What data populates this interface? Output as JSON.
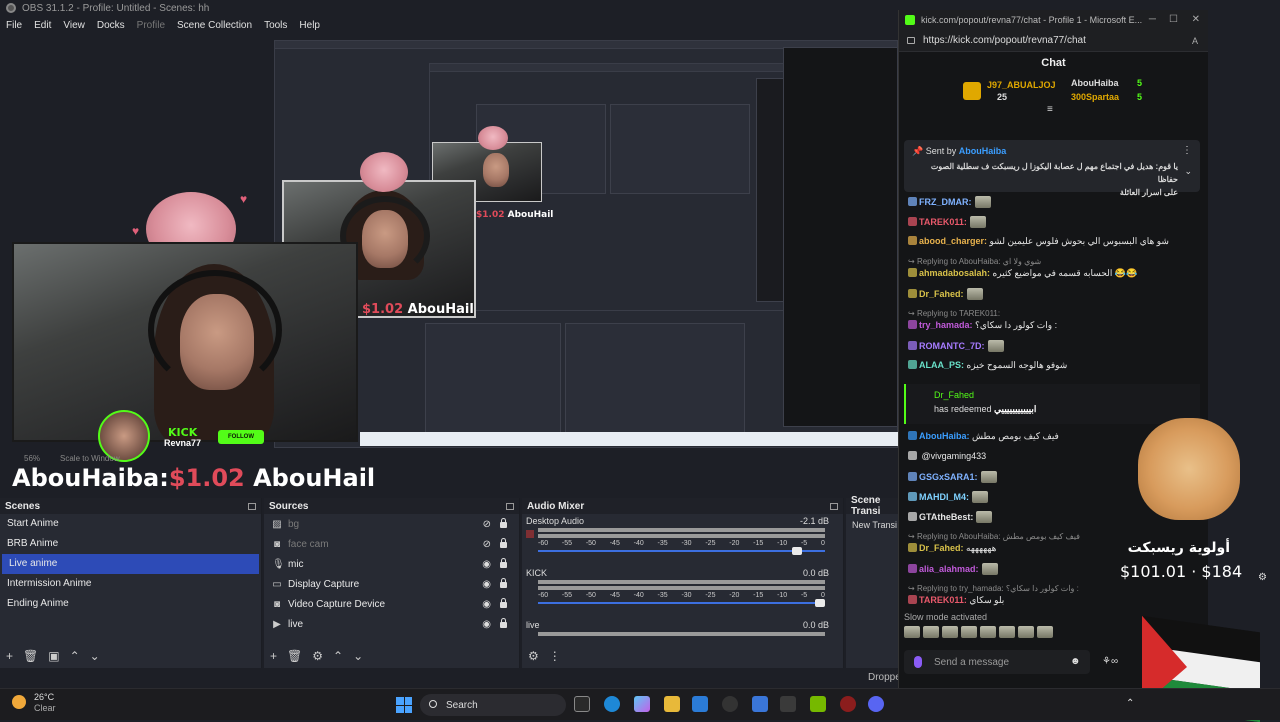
{
  "window": {
    "title": "OBS 31.1.2 - Profile: Untitled - Scenes: hh"
  },
  "menu": [
    "File",
    "Edit",
    "View",
    "Docks",
    "Profile",
    "Scene Collection",
    "Tools",
    "Help"
  ],
  "preview": {
    "kick_label": "KICK",
    "streamer_name": "Revna77",
    "follow_label": "FOLLOW",
    "donation_name": "AbouHail",
    "donation_amount": "$1.02",
    "big_overlay_prefix": "AbouHaiba:",
    "big_overlay_amount": "$1.02",
    "big_overlay_name": "AbouHail",
    "zoom": "56%",
    "scale_label": "Scale to Window"
  },
  "docks": {
    "scenes": {
      "title": "Scenes",
      "items": [
        "Start Anime",
        "BRB Anime",
        "Live anime",
        "Intermission Anime",
        "Ending Anime"
      ],
      "active_index": 2
    },
    "sources": {
      "title": "Sources",
      "items": [
        {
          "label": "bg",
          "icon": "image-icon",
          "hidden": true
        },
        {
          "label": "face cam",
          "icon": "camera-icon",
          "hidden": true
        },
        {
          "label": "mic",
          "icon": "mic-icon",
          "hidden": false
        },
        {
          "label": "Display Capture",
          "icon": "monitor-icon",
          "hidden": false
        },
        {
          "label": "Video Capture Device",
          "icon": "camera-icon",
          "hidden": false
        },
        {
          "label": "live",
          "icon": "play-icon",
          "hidden": false
        }
      ]
    },
    "mixer": {
      "title": "Audio Mixer",
      "channels": [
        {
          "label": "Desktop Audio",
          "db": "-2.1 dB",
          "level": 0.92
        },
        {
          "label": "KICK",
          "db": "0.0 dB",
          "level": 1.0
        },
        {
          "label": "live",
          "db": "0.0 dB",
          "level": 1.0
        }
      ],
      "ticks": [
        "-60",
        "-55",
        "-50",
        "-45",
        "-40",
        "-35",
        "-30",
        "-25",
        "-20",
        "-15",
        "-10",
        "-5",
        "0"
      ]
    },
    "transitions": {
      "title": "Scene Transi",
      "button": "New Transi"
    }
  },
  "status": {
    "dropped": "Droppe"
  },
  "browser": {
    "title": "kick.com/popout/revna77/chat - Profile 1 - Microsoft E...",
    "url": "https://kick.com/popout/revna77/chat",
    "chat_title": "Chat",
    "leaderboard": [
      {
        "name": "J97_ABUALJOJ",
        "count": "25"
      },
      {
        "name": "AbouHaiba",
        "count": "5"
      },
      {
        "name": "300Spartaa",
        "count": "5"
      }
    ],
    "pinned": {
      "sent_by_label": "Sent by",
      "sender": "AbouHaiba",
      "text_line1": "يا قوم: هديل في اجتماع مهم ل عصابة اليكوزا ل ريسبكت ف سطلية الصوت حفاظا",
      "text_line2": "على اسرار العائلة"
    },
    "messages": [
      {
        "user": "FRZ_DMAR:",
        "text": "",
        "color": "#7fb2ff",
        "reply": ""
      },
      {
        "user": "TAREK011:",
        "text": "",
        "color": "#e8596b",
        "reply": ""
      },
      {
        "user": "abood_charger:",
        "text": "شو هاي البسبوس الي بحوش فلوس عليمين لشو",
        "color": "#e8b24d",
        "reply": ""
      },
      {
        "user": "ahmadabosalah:",
        "text": "الحسابه قسمه في مواضيع كثيره 😂😂",
        "color": "#d9c24a",
        "reply": "Replying to AbouHaiba: شوي ولا اي"
      },
      {
        "user": "Dr_Fahed:",
        "text": "",
        "color": "#d9c24a",
        "reply": ""
      },
      {
        "user": "try_hamada:",
        "text": "وات كولور دا سكاي؟ :",
        "color": "#c05ad9",
        "reply": "Replying to TAREK011:"
      },
      {
        "user": "ROMANTC_7D:",
        "text": "",
        "color": "#a77cff",
        "reply": ""
      },
      {
        "user": "ALAA_PS:",
        "text": "شوفو هالوجه السموح خيزه",
        "color": "#69e1c9",
        "reply": ""
      }
    ],
    "redeem": {
      "user": "Dr_Fahed",
      "text": "has redeemed",
      "value": "ابيييييييييييي"
    },
    "messages2": [
      {
        "user": "AbouHaiba:",
        "text": "فيف كيف بومص مطش",
        "color": "#3b9eff",
        "reply": ""
      },
      {
        "user": "",
        "text": "@vivgaming433",
        "color": "#e6e6e6",
        "reply": ""
      },
      {
        "user": "GSGxSARA1:",
        "text": "",
        "color": "#7fb2ff",
        "reply": ""
      },
      {
        "user": "MAHDI_M4:",
        "text": "",
        "color": "#7fd2ff",
        "reply": ""
      },
      {
        "user": "GTAtheBest:",
        "text": "",
        "color": "#e6e6e6",
        "reply": ""
      },
      {
        "user": "Dr_Fahed:",
        "text": "ههههههه",
        "color": "#d9c24a",
        "reply": "Replying to AbouHaiba: فيف كيف بومص مطش"
      },
      {
        "user": "alia_alahmad:",
        "text": "",
        "color": "#c05ad9",
        "reply": ""
      },
      {
        "user": "TAREK011:",
        "text": "بلو سكاي",
        "color": "#e8596b",
        "reply": "Replying to try_hamada: وات كولور دا سكاي؟ :"
      }
    ],
    "slow_mode": "Slow mode activated",
    "send_placeholder": "Send a message",
    "donation_overlay": {
      "arabic": "أولوية ريسبكت",
      "amount": "$101.01 · $184"
    }
  },
  "taskbar": {
    "weather_temp": "26°C",
    "weather_desc": "Clear",
    "search": "Search"
  }
}
